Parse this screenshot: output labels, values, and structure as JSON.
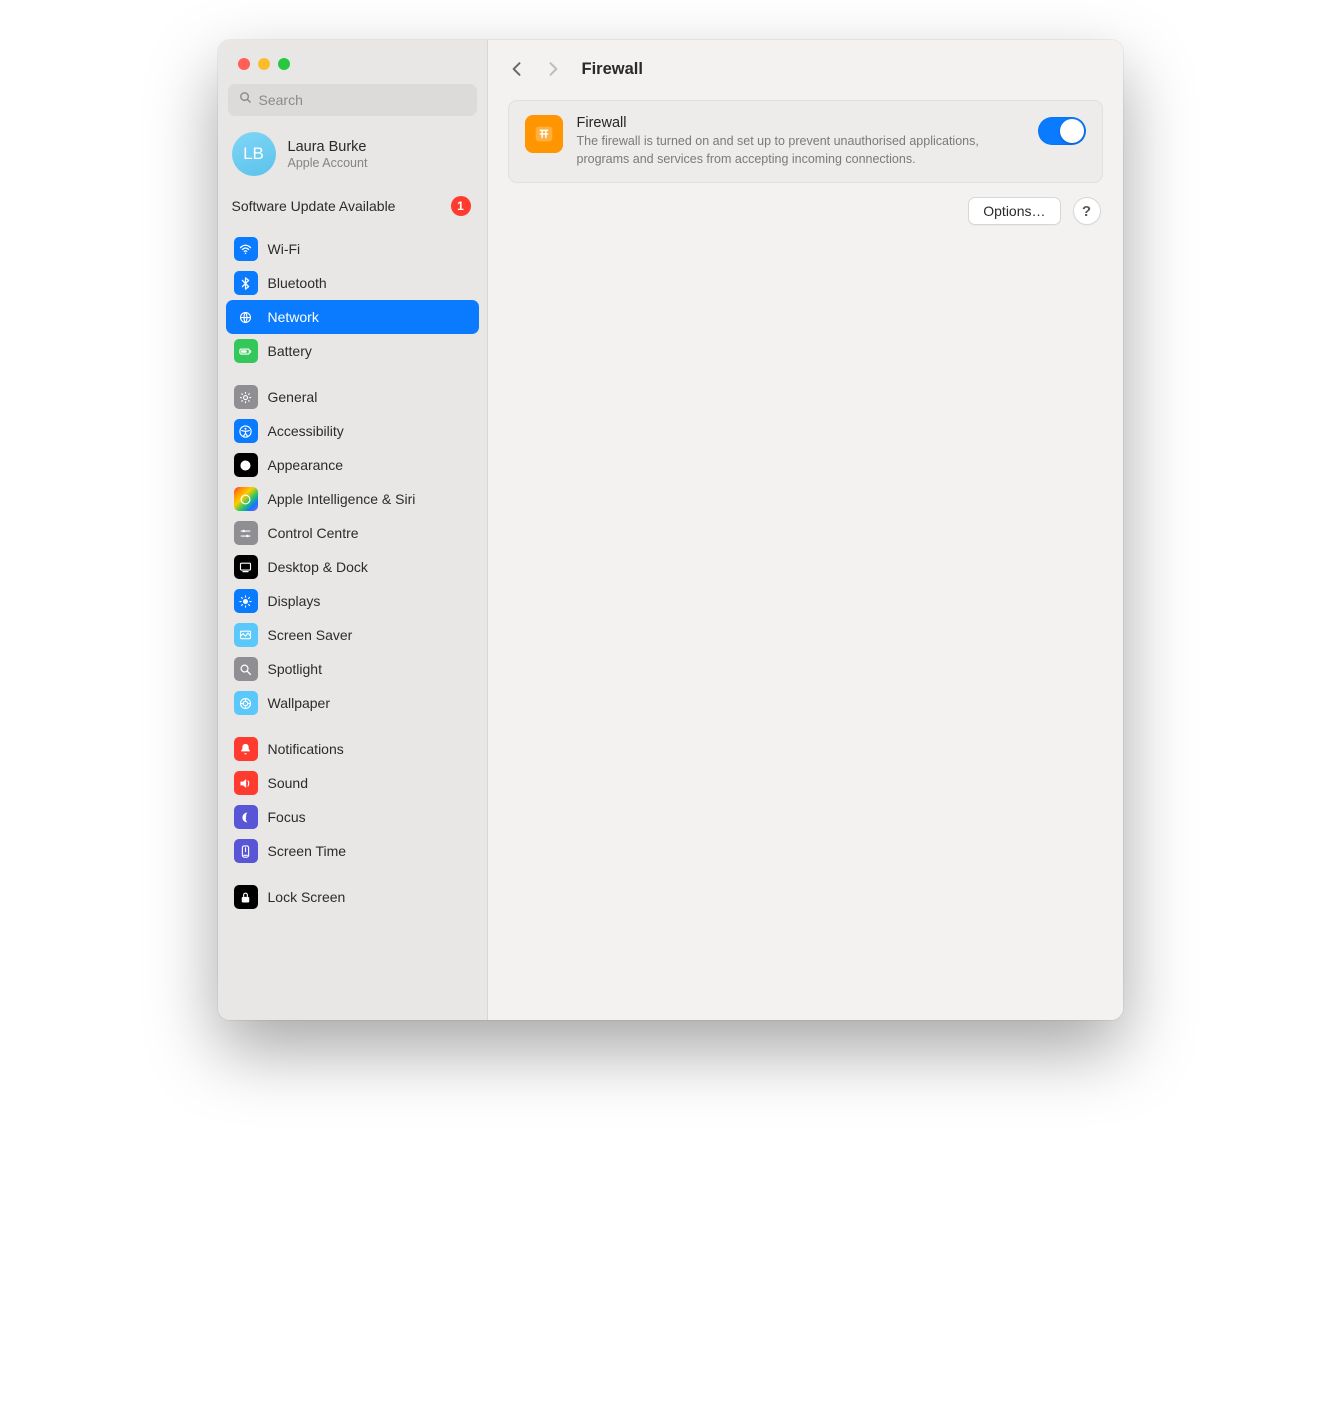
{
  "search": {
    "placeholder": "Search"
  },
  "account": {
    "initials": "LB",
    "name": "Laura Burke",
    "sub": "Apple Account"
  },
  "update": {
    "label": "Software Update Available",
    "count": "1"
  },
  "sidebar": {
    "g1": [
      {
        "name": "wifi",
        "label": "Wi-Fi",
        "color": "ic-blue"
      },
      {
        "name": "bluetooth",
        "label": "Bluetooth",
        "color": "ic-blue"
      },
      {
        "name": "network",
        "label": "Network",
        "color": "ic-blue",
        "selected": true
      },
      {
        "name": "battery",
        "label": "Battery",
        "color": "ic-green"
      }
    ],
    "g2": [
      {
        "name": "general",
        "label": "General",
        "color": "ic-gray"
      },
      {
        "name": "accessibility",
        "label": "Accessibility",
        "color": "ic-blue"
      },
      {
        "name": "appearance",
        "label": "Appearance",
        "color": "ic-black"
      },
      {
        "name": "siri",
        "label": "Apple Intelligence & Siri",
        "color": "ic-grad"
      },
      {
        "name": "controlcentre",
        "label": "Control Centre",
        "color": "ic-gray"
      },
      {
        "name": "desktopdock",
        "label": "Desktop & Dock",
        "color": "ic-black"
      },
      {
        "name": "displays",
        "label": "Displays",
        "color": "ic-blue"
      },
      {
        "name": "screensaver",
        "label": "Screen Saver",
        "color": "ic-lblue"
      },
      {
        "name": "spotlight",
        "label": "Spotlight",
        "color": "ic-gray"
      },
      {
        "name": "wallpaper",
        "label": "Wallpaper",
        "color": "ic-lblue"
      }
    ],
    "g3": [
      {
        "name": "notifications",
        "label": "Notifications",
        "color": "ic-red"
      },
      {
        "name": "sound",
        "label": "Sound",
        "color": "ic-red"
      },
      {
        "name": "focus",
        "label": "Focus",
        "color": "ic-indigo"
      },
      {
        "name": "screentime",
        "label": "Screen Time",
        "color": "ic-indigo"
      }
    ],
    "g4": [
      {
        "name": "lockscreen",
        "label": "Lock Screen",
        "color": "ic-black"
      }
    ]
  },
  "page": {
    "title": "Firewall",
    "card": {
      "title": "Firewall",
      "desc": "The firewall is turned on and set up to prevent unauthorised applications, programs and services from accepting incoming connections.",
      "enabled": true
    },
    "options_label": "Options…",
    "help_label": "?"
  }
}
